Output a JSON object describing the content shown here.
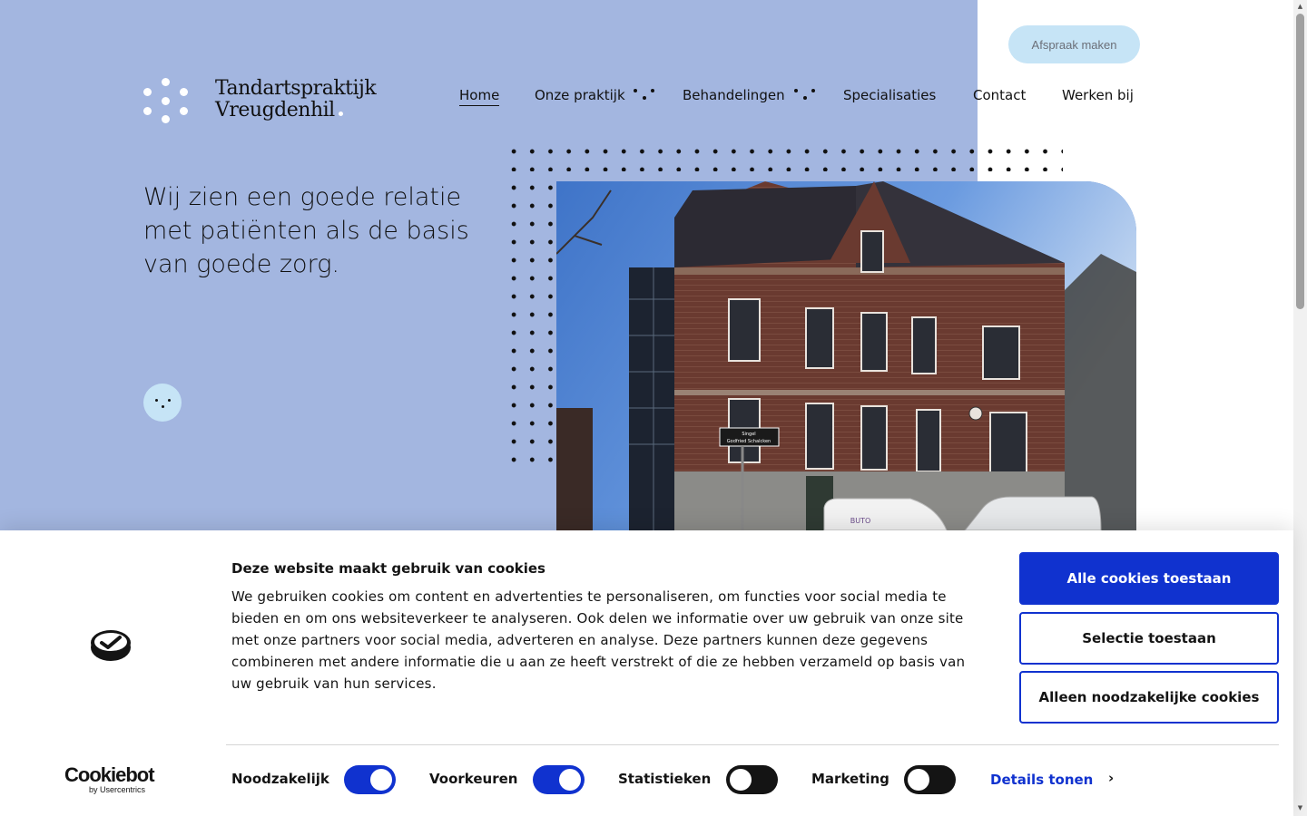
{
  "site": {
    "logo_line1": "Tandartspraktijk",
    "logo_line2": "Vreugdenhil",
    "cta": "Afspraak maken",
    "nav": [
      "Home",
      "Onze praktijk",
      "Behandelingen",
      "Specialisaties",
      "Contact",
      "Werken bij"
    ],
    "nav_active": "Home",
    "tagline": "Wij zien een goede relatie met patiënten als de basis van goede zorg.",
    "sign_line1": "Singel",
    "sign_line2": "Godfried Schalcken",
    "van_label": "BUTO"
  },
  "colors": {
    "hero_bg": "#a3b6e0",
    "accent_light": "#c6e4f6",
    "cookie_blue": "#1032cf"
  },
  "cookie": {
    "title": "Deze website maakt gebruik van cookies",
    "body": "We gebruiken cookies om content en advertenties te personaliseren, om functies voor social media te bieden en om ons websiteverkeer te analyseren. Ook delen we informatie over uw gebruik van onze site met onze partners voor social media, adverteren en analyse. Deze partners kunnen deze gegevens combineren met andere informatie die u aan ze heeft verstrekt of die ze hebben verzameld op basis van uw gebruik van hun services.",
    "btn_allow_all": "Alle cookies toestaan",
    "btn_allow_selection": "Selectie toestaan",
    "btn_necessary_only": "Alleen noodzakelijke cookies",
    "toggles": [
      {
        "label": "Noodzakelijk",
        "on": true
      },
      {
        "label": "Voorkeuren",
        "on": true
      },
      {
        "label": "Statistieken",
        "on": false
      },
      {
        "label": "Marketing",
        "on": false
      }
    ],
    "details": "Details tonen",
    "brand": "Cookiebot",
    "brand_by": "by Usercentrics"
  }
}
